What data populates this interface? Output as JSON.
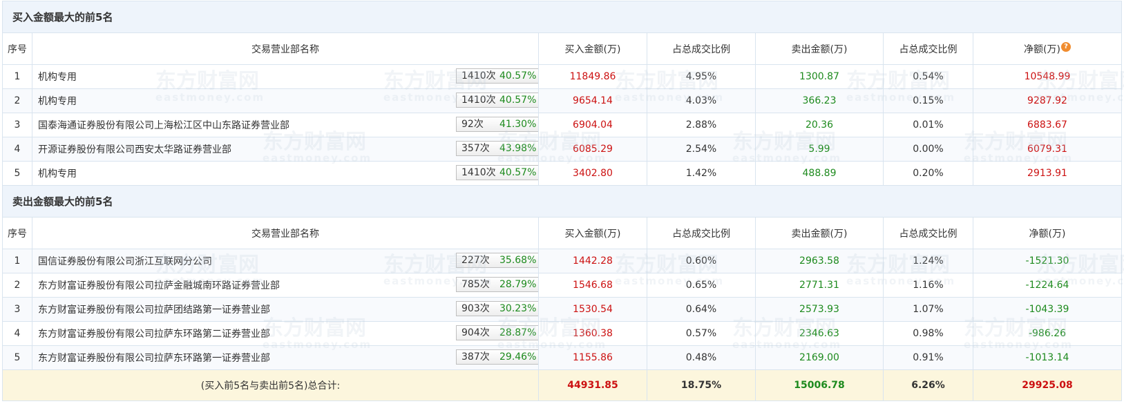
{
  "buy_section": {
    "title": "买入金额最大的前5名",
    "columns": [
      "序号",
      "交易营业部名称",
      "买入金额(万)",
      "占总成交比例",
      "卖出金额(万)",
      "占总成交比例",
      "净额(万)"
    ],
    "help_icon": "help-icon",
    "rows": [
      {
        "rank": "1",
        "name": "机构专用",
        "count": "1410次",
        "pct": "40.57%",
        "icon": "help-icon",
        "buy": "11849.86",
        "buy_ratio": "4.95%",
        "sell": "1300.87",
        "sell_ratio": "0.54%",
        "net": "10548.99"
      },
      {
        "rank": "2",
        "name": "机构专用",
        "count": "1410次",
        "pct": "40.57%",
        "icon": "triangle-right-icon",
        "buy": "9654.14",
        "buy_ratio": "4.03%",
        "sell": "366.23",
        "sell_ratio": "0.15%",
        "net": "9287.92"
      },
      {
        "rank": "3",
        "name": "国泰海通证券股份有限公司上海松江区中山东路证券营业部",
        "count": "92次",
        "pct": "41.30%",
        "icon": "triangle-right-icon",
        "buy": "6904.04",
        "buy_ratio": "2.88%",
        "sell": "20.36",
        "sell_ratio": "0.01%",
        "net": "6883.67"
      },
      {
        "rank": "4",
        "name": "开源证券股份有限公司西安太华路证券营业部",
        "count": "357次",
        "pct": "43.98%",
        "icon": "triangle-right-icon",
        "buy": "6085.29",
        "buy_ratio": "2.54%",
        "sell": "5.99",
        "sell_ratio": "0.00%",
        "net": "6079.31"
      },
      {
        "rank": "5",
        "name": "机构专用",
        "count": "1410次",
        "pct": "40.57%",
        "icon": "triangle-right-icon",
        "buy": "3402.80",
        "buy_ratio": "1.42%",
        "sell": "488.89",
        "sell_ratio": "0.20%",
        "net": "2913.91"
      }
    ]
  },
  "sell_section": {
    "title": "卖出金额最大的前5名",
    "columns": [
      "序号",
      "交易营业部名称",
      "买入金额(万)",
      "占总成交比例",
      "卖出金额(万)",
      "占总成交比例",
      "净额(万)"
    ],
    "rows": [
      {
        "rank": "1",
        "name": "国信证券股份有限公司浙江互联网分公司",
        "count": "227次",
        "pct": "35.68%",
        "icon": "help-icon",
        "buy": "1442.28",
        "buy_ratio": "0.60%",
        "sell": "2963.58",
        "sell_ratio": "1.24%",
        "net": "-1521.30"
      },
      {
        "rank": "2",
        "name": "东方财富证券股份有限公司拉萨金融城南环路证券营业部",
        "count": "785次",
        "pct": "28.79%",
        "icon": "triangle-right-icon",
        "buy": "1546.68",
        "buy_ratio": "0.65%",
        "sell": "2771.31",
        "sell_ratio": "1.16%",
        "net": "-1224.64"
      },
      {
        "rank": "3",
        "name": "东方财富证券股份有限公司拉萨团结路第一证券营业部",
        "count": "903次",
        "pct": "30.23%",
        "icon": "triangle-right-icon",
        "buy": "1530.54",
        "buy_ratio": "0.64%",
        "sell": "2573.93",
        "sell_ratio": "1.07%",
        "net": "-1043.39"
      },
      {
        "rank": "4",
        "name": "东方财富证券股份有限公司拉萨东环路第二证券营业部",
        "count": "904次",
        "pct": "28.87%",
        "icon": "triangle-right-icon",
        "buy": "1360.38",
        "buy_ratio": "0.57%",
        "sell": "2346.63",
        "sell_ratio": "0.98%",
        "net": "-986.26"
      },
      {
        "rank": "5",
        "name": "东方财富证券股份有限公司拉萨东环路第一证券营业部",
        "count": "387次",
        "pct": "29.46%",
        "icon": "triangle-right-icon",
        "buy": "1155.86",
        "buy_ratio": "0.48%",
        "sell": "2169.00",
        "sell_ratio": "0.91%",
        "net": "-1013.14"
      }
    ]
  },
  "total": {
    "label": "(买入前5名与卖出前5名)总合计:",
    "buy": "44931.85",
    "buy_ratio": "18.75%",
    "sell": "15006.78",
    "sell_ratio": "6.26%",
    "net": "29925.08"
  },
  "watermark": {
    "text": "东方财富网",
    "sub": "eastmoney.com"
  },
  "colors": {
    "positive": "#cc1111",
    "negative": "#1d8a1d",
    "header_bg": "#eef4fb",
    "total_bg": "#fcf6dd",
    "help_icon": "#f08c2f"
  }
}
